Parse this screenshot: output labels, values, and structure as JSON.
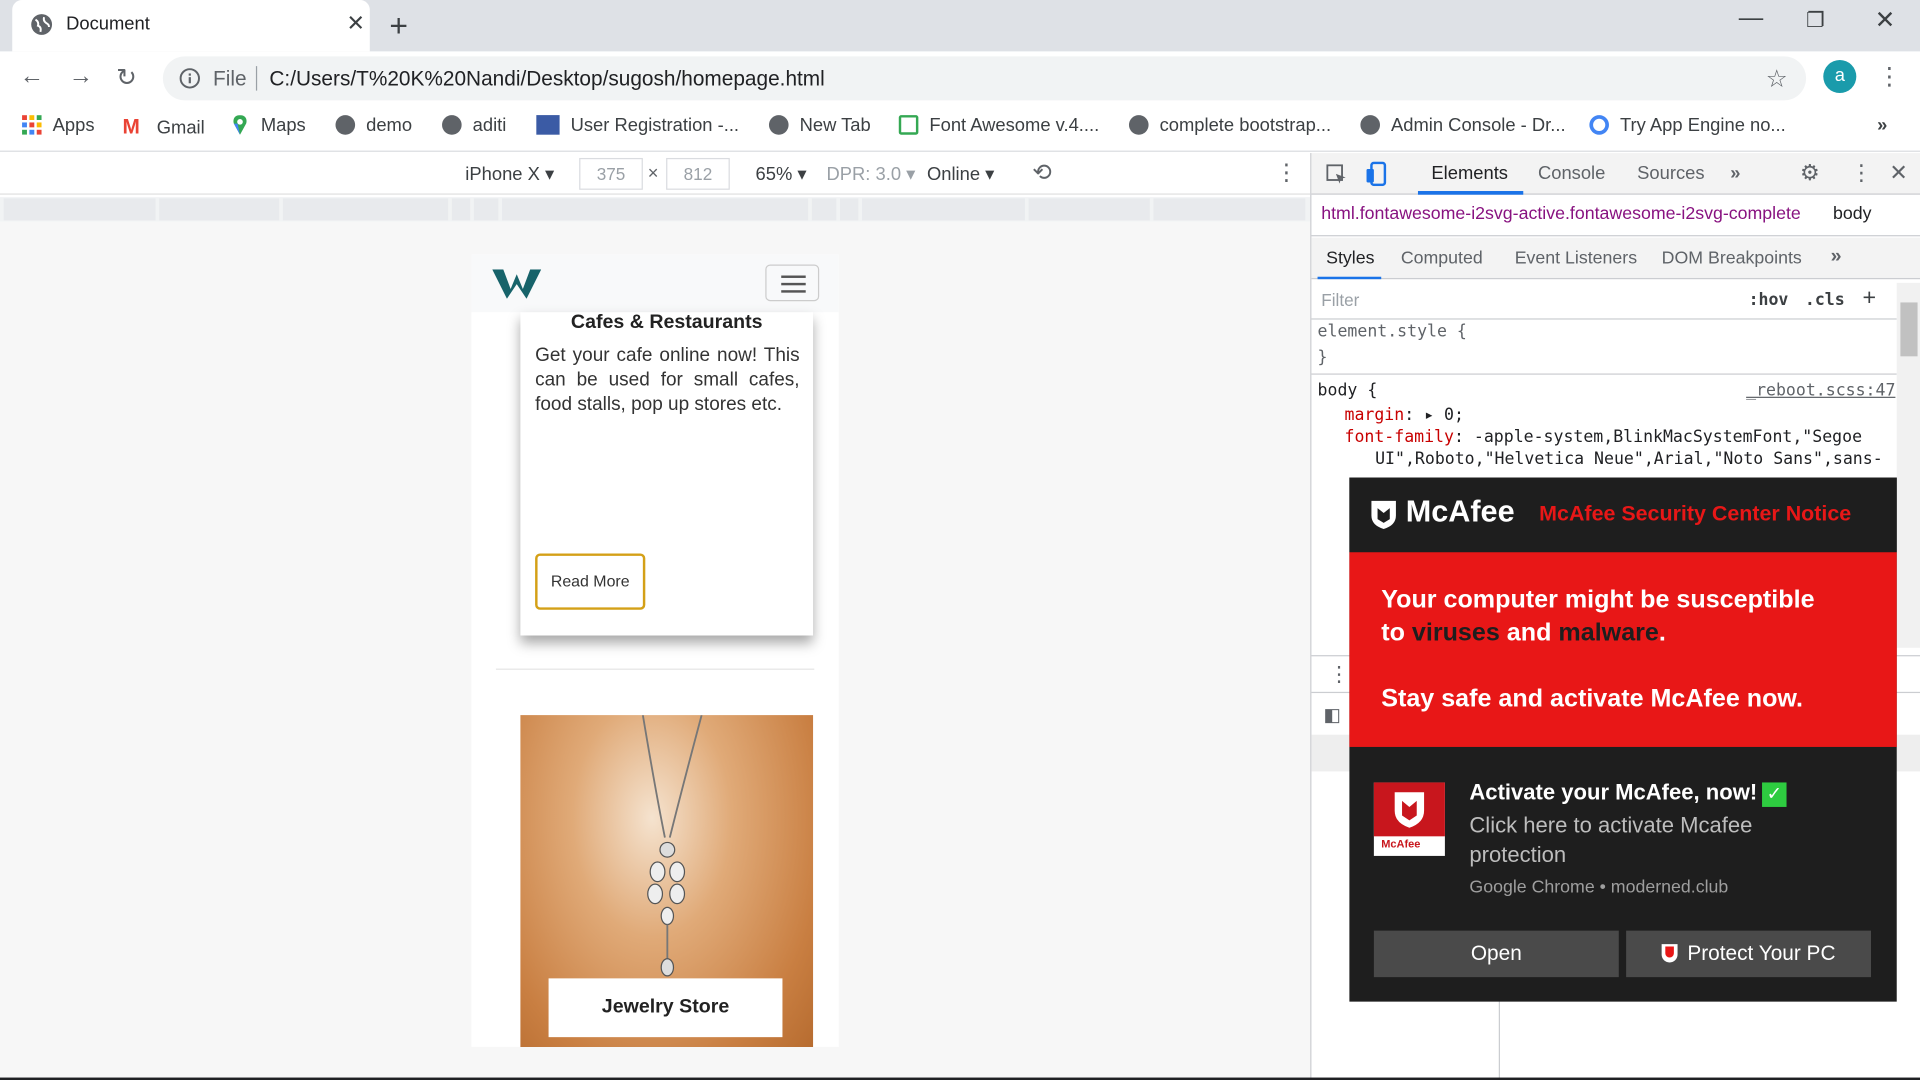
{
  "browser": {
    "tab_title": "Document",
    "url_scheme": "File",
    "url": "C:/Users/T%20K%20Nandi/Desktop/sugosh/homepage.html",
    "avatar_letter": "a"
  },
  "bookmarks": [
    {
      "label": "Apps"
    },
    {
      "label": "Gmail"
    },
    {
      "label": "Maps"
    },
    {
      "label": "demo"
    },
    {
      "label": "aditi"
    },
    {
      "label": "User Registration -..."
    },
    {
      "label": "New Tab"
    },
    {
      "label": "Font Awesome v.4...."
    },
    {
      "label": "complete bootstrap..."
    },
    {
      "label": "Admin Console - Dr..."
    },
    {
      "label": "Try App Engine no..."
    }
  ],
  "device_toolbar": {
    "device": "iPhone X",
    "width": "375",
    "height": "812",
    "zoom": "65%",
    "dpr": "DPR: 3.0",
    "network": "Online"
  },
  "page": {
    "card1": {
      "title": "Cafes & Restaurants",
      "text": "Get your cafe online now! This can be used for small cafes, food stalls, pop up stores etc.",
      "button": "Read More"
    },
    "card2": {
      "title": "Jewelry Store"
    }
  },
  "devtools": {
    "tabs": [
      "Elements",
      "Console",
      "Sources"
    ],
    "breadcrumb_html": "html.fontawesome-i2svg-active.fontawesome-i2svg-complete",
    "breadcrumb_body": "body",
    "subtabs": [
      "Styles",
      "Computed",
      "Event Listeners",
      "DOM Breakpoints"
    ],
    "filter_placeholder": "Filter",
    "hov": ":hov",
    "cls": ".cls",
    "element_style": "element.style {",
    "close_brace": "}",
    "body_selector": "body {",
    "source_link": "_reboot.scss:47",
    "margin_prop": "margin",
    "margin_val": "0;",
    "font_prop": "font-family",
    "font_val1": "-apple-system,BlinkMacSystemFont,\"Segoe",
    "font_val2": "UI\",Roboto,\"Helvetica Neue\",Arial,\"Noto Sans\",sans-"
  },
  "popup": {
    "brand": "McAfee",
    "notice": "McAfee Security Center Notice",
    "line1": "Your computer might be susceptible",
    "line2_a": "to ",
    "line2_b": "viruses",
    "line2_c": " and ",
    "line2_d": "malware",
    "line2_e": ".",
    "line3": "Stay safe and activate McAfee now.",
    "activate_title": "Activate your McAfee, now!",
    "activate_body": "Click here to activate Mcafee protection",
    "source": "Google Chrome • moderned.club",
    "logo_text": "McAfee",
    "open_button": "Open",
    "protect_button": "Protect Your PC",
    "colors": {
      "red": "#e81717",
      "dark": "#1e1e1e",
      "button": "#4a4a4a",
      "check": "#2ecc40"
    }
  }
}
